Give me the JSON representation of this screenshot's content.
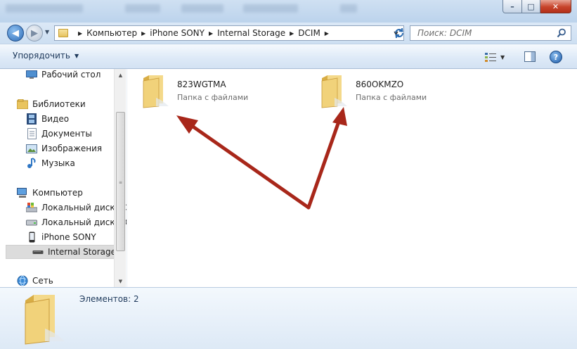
{
  "window": {
    "controls": {
      "minimize": "–",
      "maximize": "□",
      "close": "✕"
    }
  },
  "address_bar": {
    "breadcrumb": [
      "Компьютер",
      "iPhone SONY",
      "Internal Storage",
      "DCIM"
    ]
  },
  "search": {
    "placeholder": "Поиск: DCIM"
  },
  "toolbar": {
    "organize_label": "Упорядочить",
    "help_label": "?"
  },
  "sidebar": {
    "items": [
      {
        "label": "Рабочий стол",
        "icon": "desktop-icon"
      },
      {
        "label": "Библиотеки",
        "icon": "libraries-icon"
      },
      {
        "label": "Видео",
        "icon": "video-icon"
      },
      {
        "label": "Документы",
        "icon": "documents-icon"
      },
      {
        "label": "Изображения",
        "icon": "pictures-icon"
      },
      {
        "label": "Музыка",
        "icon": "music-icon"
      },
      {
        "label": "Компьютер",
        "icon": "computer-icon"
      },
      {
        "label": "Локальный диск (C",
        "icon": "system-drive-icon"
      },
      {
        "label": "Локальный диск (D",
        "icon": "drive-icon"
      },
      {
        "label": "iPhone SONY",
        "icon": "phone-icon"
      },
      {
        "label": "Internal Storage",
        "icon": "storage-icon",
        "selected": true
      },
      {
        "label": "Сеть",
        "icon": "network-icon"
      }
    ]
  },
  "main": {
    "folders": [
      {
        "name": "823WGTMA",
        "type": "Папка с файлами"
      },
      {
        "name": "860OKMZO",
        "type": "Папка с файлами"
      }
    ]
  },
  "details": {
    "item_count": "Элементов: 2"
  },
  "colors": {
    "annotation_arrow": "#a8271a",
    "folder_yellow": "#f1d27a",
    "accent_blue": "#1e395b"
  }
}
